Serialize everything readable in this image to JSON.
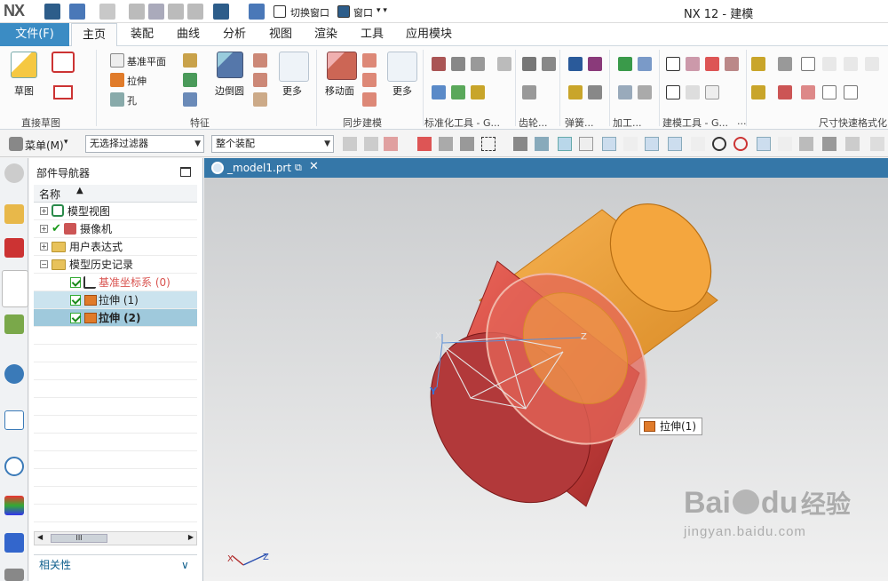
{
  "app": {
    "logo": "NX",
    "title": "NX 12 - 建模",
    "switch_window": "切换窗口",
    "window_menu": "窗口"
  },
  "tabs": {
    "file": "文件(F)",
    "items": [
      "主页",
      "装配",
      "曲线",
      "分析",
      "视图",
      "渲染",
      "工具",
      "应用模块"
    ],
    "active_index": 0
  },
  "ribbon": {
    "sketch": "草图",
    "datum_plane": "基准平面",
    "extrude": "拉伸",
    "hole": "孔",
    "edge_blend": "边倒圆",
    "more1": "更多",
    "move_face": "移动面",
    "more2": "更多",
    "groups": {
      "direct_sketch": "直接草图",
      "feature": "特征",
      "sync_modeling": "同步建模",
      "std_tools": "标准化工具 - G...",
      "gear": "齿轮...",
      "spring": "弹簧...",
      "machining": "加工...",
      "modeling_tools": "建模工具 - G...",
      "more": "...",
      "dim_format": "尺寸快速格式化"
    }
  },
  "selbar": {
    "menu": "菜单(M)",
    "filter": "无选择过滤器",
    "scope": "整个装配"
  },
  "navigator": {
    "title": "部件导航器",
    "col_name": "名称",
    "nodes": [
      {
        "label": "模型视图"
      },
      {
        "label": "摄像机"
      },
      {
        "label": "用户表达式"
      },
      {
        "label": "模型历史记录"
      },
      {
        "label": "基准坐标系 (0)"
      },
      {
        "label": "拉伸 (1)"
      },
      {
        "label": "拉伸 (2)"
      }
    ],
    "scroll_thumb": "III",
    "related": "相关性"
  },
  "graphics": {
    "doc_tab": "_model1.prt",
    "tooltip": "拉伸(1)",
    "axes": {
      "x": "X",
      "y": "Y",
      "z": "Z"
    },
    "colors": {
      "base_cylinder": "#e25b52",
      "top_cylinder": "#f2a43c",
      "ribbon_accent": "#3b8cc4"
    }
  },
  "watermark": {
    "brand": "Bai",
    "brand2": "du",
    "suffix": "经验",
    "url": "jingyan.baidu.com"
  }
}
